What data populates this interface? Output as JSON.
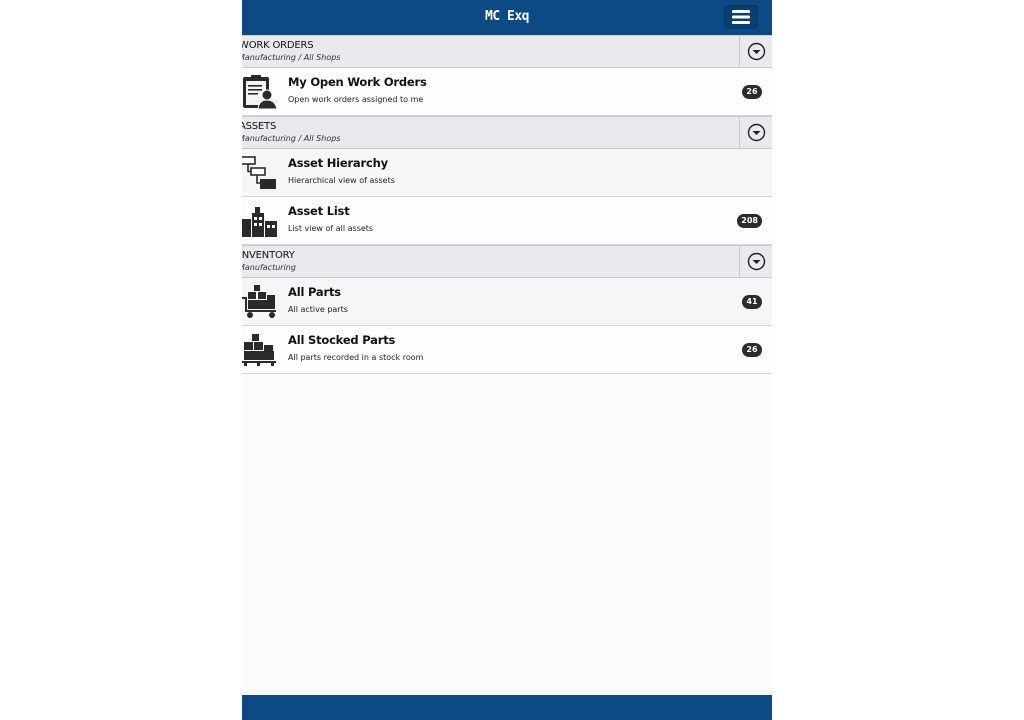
{
  "app": {
    "title": "MC Exq"
  },
  "sections": [
    {
      "title": "WORK ORDERS",
      "subtitle": "Manufacturing / All Shops",
      "items": [
        {
          "title": "My Open Work Orders",
          "description": "Open work orders assigned to me",
          "count": "26",
          "icon": "work-order-clipboard-icon"
        }
      ]
    },
    {
      "title": "ASSETS",
      "subtitle": "Manufacturing / All Shops",
      "items": [
        {
          "title": "Asset Hierarchy",
          "description": "Hierarchical view of assets",
          "count": "",
          "icon": "hierarchy-tree-icon"
        },
        {
          "title": "Asset List",
          "description": "List view of all assets",
          "count": "208",
          "icon": "factory-icon"
        }
      ]
    },
    {
      "title": "INVENTORY",
      "subtitle": "Manufacturing",
      "items": [
        {
          "title": "All Parts",
          "description": "All active parts",
          "count": "41",
          "icon": "parts-cart-icon"
        },
        {
          "title": "All Stocked Parts",
          "description": "All parts recorded in a stock room",
          "count": "26",
          "icon": "stocked-pallet-icon"
        }
      ]
    }
  ],
  "colors": {
    "header": "#0d4a85",
    "section_bg": "#e9e9ee",
    "badge": "#2b2b2b"
  }
}
